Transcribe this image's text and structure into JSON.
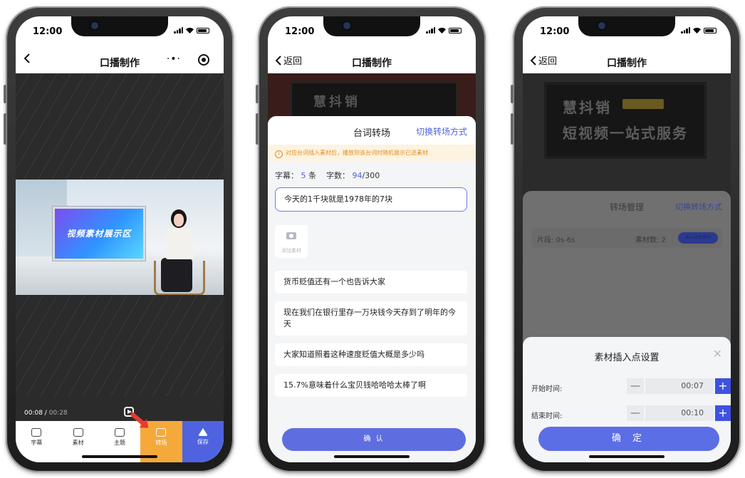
{
  "status_time": "12:00",
  "phone1": {
    "nav_title": "口播制作",
    "nav_more": "·•·",
    "video_banner": "视频素材展示区",
    "time_current": "00:08 /",
    "time_total": "00:28",
    "tabs": [
      {
        "label": "字幕",
        "icon": "subtitle-icon"
      },
      {
        "label": "素材",
        "icon": "folder-icon"
      },
      {
        "label": "主题",
        "icon": "cube-icon"
      },
      {
        "label": "转场",
        "icon": "transition-icon",
        "highlight": "#f5a93b"
      },
      {
        "label": "保存",
        "icon": "send-icon",
        "highlight": "#4f63e0"
      }
    ]
  },
  "phone2": {
    "back_label": "返回",
    "nav_title": "口播制作",
    "bg_banner": "慧抖销",
    "sheet_title": "台词转场",
    "switch_label": "切换转场方式",
    "tip": "对应台词插入素材后，播放到该台词时随机展示已选素材",
    "subtitle_label": "字幕：",
    "subtitle_count": "5",
    "subtitle_unit": "条",
    "chars_label": "字数：",
    "chars_count": "94",
    "chars_max": "/300",
    "active_line": "今天的1千块就是1978年的7块",
    "add_material": "添加素材",
    "lines": [
      "货币贬值还有一个也告诉大家",
      "现在我们在银行里存一万块钱今天存到了明年的今天",
      "大家知道照着这种速度贬值大概是多少吗",
      "15.7%意味着什么宝贝钱哈哈哈太棒了啊"
    ],
    "confirm": "确 认"
  },
  "phone3": {
    "back_label": "返回",
    "nav_title": "口播制作",
    "bg_line1": "慧抖销",
    "bg_line2": "短视频一站式服务",
    "mgr_title": "转场管理",
    "switch_label": "切换转场方式",
    "segment": "片段: 0s-6s",
    "material_count": "素材数: 2",
    "insert_button": "插入转场素材",
    "dialog_title": "素材插入点设置",
    "start_label": "开始时间:",
    "start_value": "00:07",
    "end_label": "结束时间:",
    "end_value": "00:10",
    "confirm": "确 定"
  }
}
